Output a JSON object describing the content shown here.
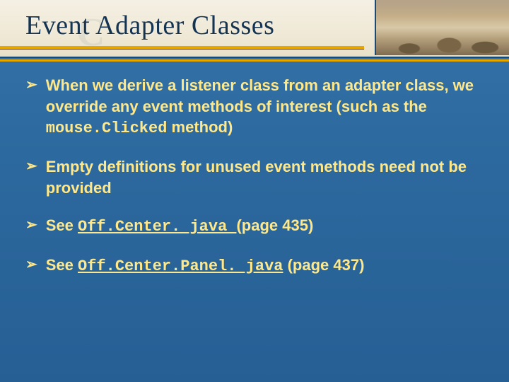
{
  "title": "Event Adapter Classes",
  "watermark": "C",
  "bullets": [
    {
      "pre": "When we derive a listener class from an adapter class, we override any event methods of interest (such as the ",
      "code": "mouse.Clicked",
      "post": " method)"
    },
    {
      "pre": "Empty definitions for unused event methods need not be provided",
      "code": "",
      "post": ""
    },
    {
      "pre": "See ",
      "link": "Off.Center. java ",
      "post": "(page 435)"
    },
    {
      "pre": "See ",
      "link": "Off.Center.Panel. java",
      "post": " (page 437)"
    }
  ]
}
